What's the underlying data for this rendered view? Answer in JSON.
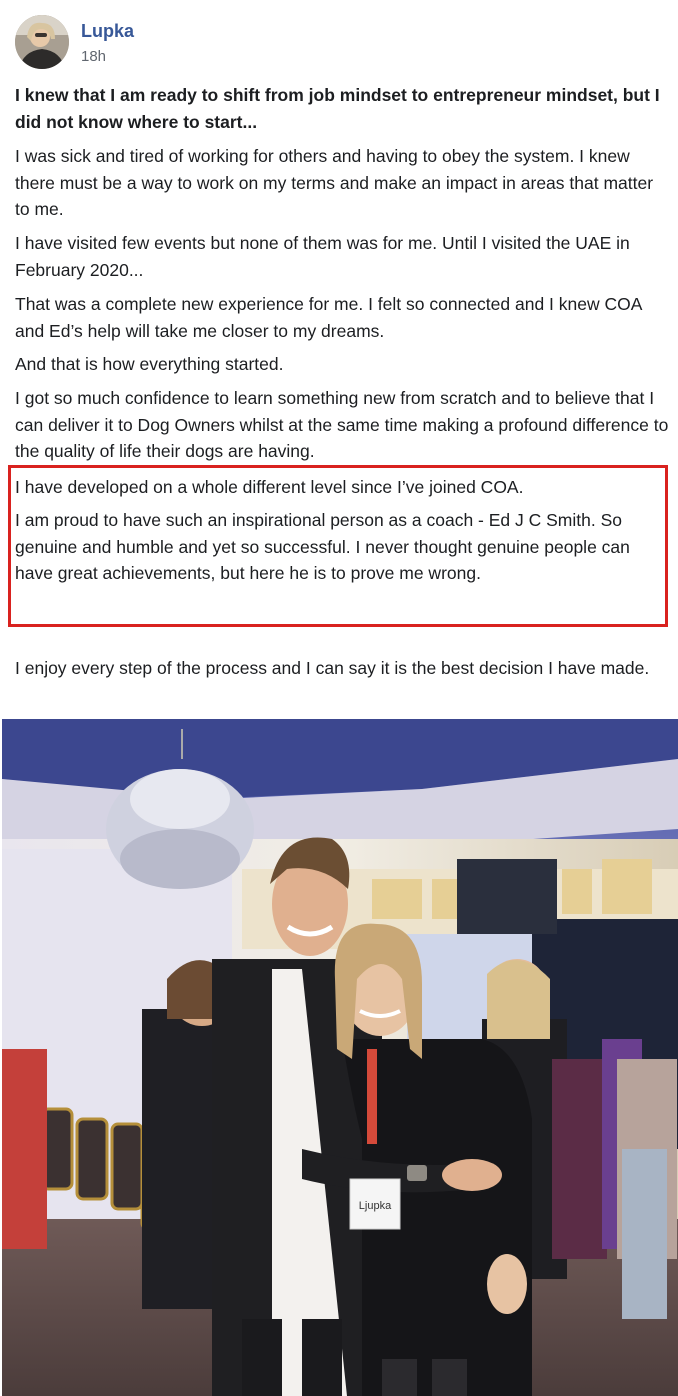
{
  "post": {
    "author": "Lupka",
    "time": "18h",
    "avatar_icon": "user-avatar",
    "paragraphs": [
      "I knew that I am ready to shift from job mindset to entrepreneur mindset, but I did not know where to start...",
      "I was sick and tired of working for others and having to obey the system. I knew there must be a way to work on my terms and make an impact in areas that matter to me.",
      "I have visited few events but none of them was for me. Until I visited the UAE in February 2020...",
      "That was a complete new experience for me. I felt so connected and I knew COA and Ed’s help will take me closer to my dreams.",
      "And that is how everything started.",
      "I got so much confidence to learn something new from scratch and to believe that I can deliver it to Dog Owners whilst at the same time making a profound difference to the quality of life their dogs are having.",
      "I have developed on a whole different level since I’ve joined COA.",
      "I am proud to have such an inspirational person as a coach - Ed J C Smith. So genuine and humble and yet so successful. I never thought genuine people can have great achievements, but here he is to prove me wrong.",
      "I enjoy every step of the process and I can say it is the best decision I have made."
    ],
    "highlight_color": "#d9221f",
    "author_color": "#385898",
    "photo": {
      "name_badge": "Ljupka"
    }
  }
}
